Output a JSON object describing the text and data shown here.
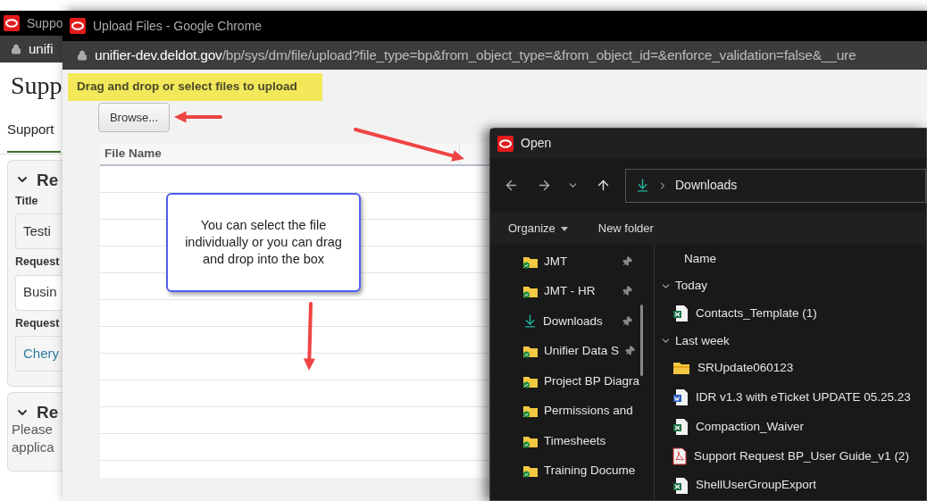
{
  "background_window": {
    "title": "Suppo",
    "address": "unifi",
    "heading": "Supp",
    "tab": "Support",
    "sections": [
      {
        "heading": "Re",
        "expanded": true,
        "fields": [
          {
            "label": "Title",
            "value": "Testi",
            "kind": "text"
          },
          {
            "label": "Request",
            "value": "Busin",
            "kind": "select"
          },
          {
            "label": "Request",
            "value": "Chery",
            "kind": "link"
          }
        ]
      },
      {
        "heading": "Re",
        "expanded": true,
        "text_lines": [
          "Please",
          "applica"
        ]
      }
    ]
  },
  "upload_window": {
    "title": "Upload Files - Google Chrome",
    "url_host": "unifier-dev.deldot.gov",
    "url_path": "/bp/sys/dm/file/upload?file_type=bp&from_object_type=&from_object_id=&enforce_validation=false&__ure",
    "instruction": "Drag and drop or select files to upload",
    "browse_button": "Browse...",
    "table": {
      "columns": [
        "File Name"
      ]
    }
  },
  "callout": "You can select the file individually or you can drag and drop into the box",
  "open_dialog": {
    "title": "Open",
    "breadcrumb": "Downloads",
    "toolbar": [
      {
        "label": "Organize",
        "kind": "menu"
      },
      {
        "label": "New folder",
        "kind": "button"
      }
    ],
    "nav_items": [
      {
        "label": "JMT",
        "kind": "synced-folder",
        "pinned": true
      },
      {
        "label": "JMT - HR",
        "kind": "synced-folder",
        "pinned": true
      },
      {
        "label": "Downloads",
        "kind": "downloads",
        "pinned": true
      },
      {
        "label": "Unifier Data S",
        "kind": "synced-folder",
        "pinned": true
      },
      {
        "label": "Project BP Diagra",
        "kind": "synced-folder",
        "pinned": false
      },
      {
        "label": "Permissions and",
        "kind": "synced-folder",
        "pinned": false
      },
      {
        "label": "Timesheets",
        "kind": "synced-folder",
        "pinned": false
      },
      {
        "label": "Training Docume",
        "kind": "synced-folder",
        "pinned": false
      }
    ],
    "column": "Name",
    "groups": [
      {
        "label": "Today",
        "expanded": true,
        "files": [
          {
            "name": "Contacts_Template (1)",
            "kind": "excel"
          }
        ]
      },
      {
        "label": "Last week",
        "expanded": true,
        "files": [
          {
            "name": "SRUpdate060123",
            "kind": "folder"
          },
          {
            "name": "IDR v1.3 with eTicket UPDATE 05.25.23",
            "kind": "word"
          },
          {
            "name": "Compaction_Waiver",
            "kind": "excel"
          },
          {
            "name": "Support Request BP_User Guide_v1 (2)",
            "kind": "pdf"
          },
          {
            "name": "ShellUserGroupExport",
            "kind": "excel"
          }
        ]
      }
    ]
  }
}
